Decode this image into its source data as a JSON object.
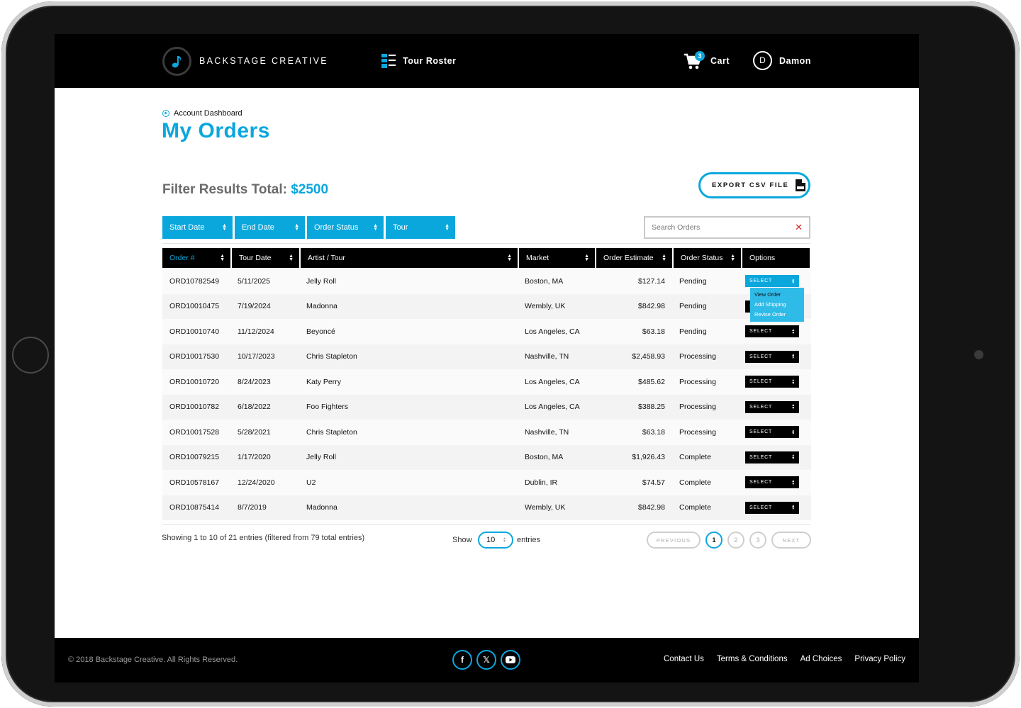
{
  "brand": {
    "name": "BACKSTAGE CREATIVE",
    "logo_icon": "music-note-icon"
  },
  "nav": {
    "roster_label": "Tour Roster",
    "cart_label": "Cart",
    "cart_count": "3",
    "user_initial": "D",
    "user_name": "Damon"
  },
  "page": {
    "breadcrumb": "Account Dashboard",
    "title": "My Orders",
    "filter_total_label": "Filter Results Total:",
    "filter_total_value": "$2500",
    "export_label": "EXPORT CSV FILE"
  },
  "filters": {
    "start_date": "Start Date",
    "end_date": "End Date",
    "order_status": "Order Status",
    "tour": "Tour",
    "search_placeholder": "Search Orders"
  },
  "table": {
    "columns": [
      "Order #",
      "Tour Date",
      "Artist / Tour",
      "Market",
      "Order Estimate",
      "Order Status",
      "Options"
    ],
    "select_label": "SELECT",
    "rows": [
      {
        "order": "ORD10782549",
        "date": "5/11/2025",
        "artist": "Jelly Roll",
        "market": "Boston, MA",
        "estimate": "$127.14",
        "status": "Pending"
      },
      {
        "order": "ORD10010475",
        "date": "7/19/2024",
        "artist": "Madonna",
        "market": "Wembly, UK",
        "estimate": "$842.98",
        "status": "Pending"
      },
      {
        "order": "ORD10010740",
        "date": "11/12/2024",
        "artist": "Beyoncé",
        "market": "Los Angeles, CA",
        "estimate": "$63.18",
        "status": "Pending"
      },
      {
        "order": "ORD10017530",
        "date": "10/17/2023",
        "artist": "Chris Stapleton",
        "market": "Nashville, TN",
        "estimate": "$2,458.93",
        "status": "Processing"
      },
      {
        "order": "ORD10010720",
        "date": "8/24/2023",
        "artist": "Katy Perry",
        "market": "Los Angeles, CA",
        "estimate": "$485.62",
        "status": "Processing"
      },
      {
        "order": "ORD10010782",
        "date": "6/18/2022",
        "artist": "Foo Fighters",
        "market": "Los Angeles, CA",
        "estimate": "$388.25",
        "status": "Processing"
      },
      {
        "order": "ORD10017528",
        "date": "5/28/2021",
        "artist": "Chris Stapleton",
        "market": "Nashville, TN",
        "estimate": "$63.18",
        "status": "Processing"
      },
      {
        "order": "ORD10079215",
        "date": "1/17/2020",
        "artist": "Jelly Roll",
        "market": "Boston, MA",
        "estimate": "$1,926.43",
        "status": "Complete"
      },
      {
        "order": "ORD10578167",
        "date": "12/24/2020",
        "artist": "U2",
        "market": "Dublin, IR",
        "estimate": "$74.57",
        "status": "Complete"
      },
      {
        "order": "ORD10875414",
        "date": "8/7/2019",
        "artist": "Madonna",
        "market": "Wembly, UK",
        "estimate": "$842.98",
        "status": "Complete"
      }
    ],
    "dropdown_options": [
      "View Order",
      "Add Shipping",
      "Revise Order"
    ]
  },
  "pagination": {
    "showing_text": "Showing 1 to 10 of 21 entries (filtered from 79 total entries)",
    "show_label": "Show",
    "entries_value": "10",
    "entries_label": "entries",
    "previous": "PREVIOUS",
    "next": "NEXT",
    "pages": [
      "1",
      "2",
      "3"
    ],
    "current_page": "1"
  },
  "footer": {
    "copyright": "© 2018 Backstage Creative.  All Rights Reserved.",
    "social_icons": [
      "facebook-icon",
      "x-icon",
      "youtube-icon"
    ],
    "links": [
      "Contact Us",
      "Terms & Conditions",
      "Ad Choices",
      "Privacy Policy"
    ]
  },
  "colors": {
    "accent": "#0aa7dd",
    "header_bg": "#000000",
    "clear_red": "#d9262b"
  }
}
